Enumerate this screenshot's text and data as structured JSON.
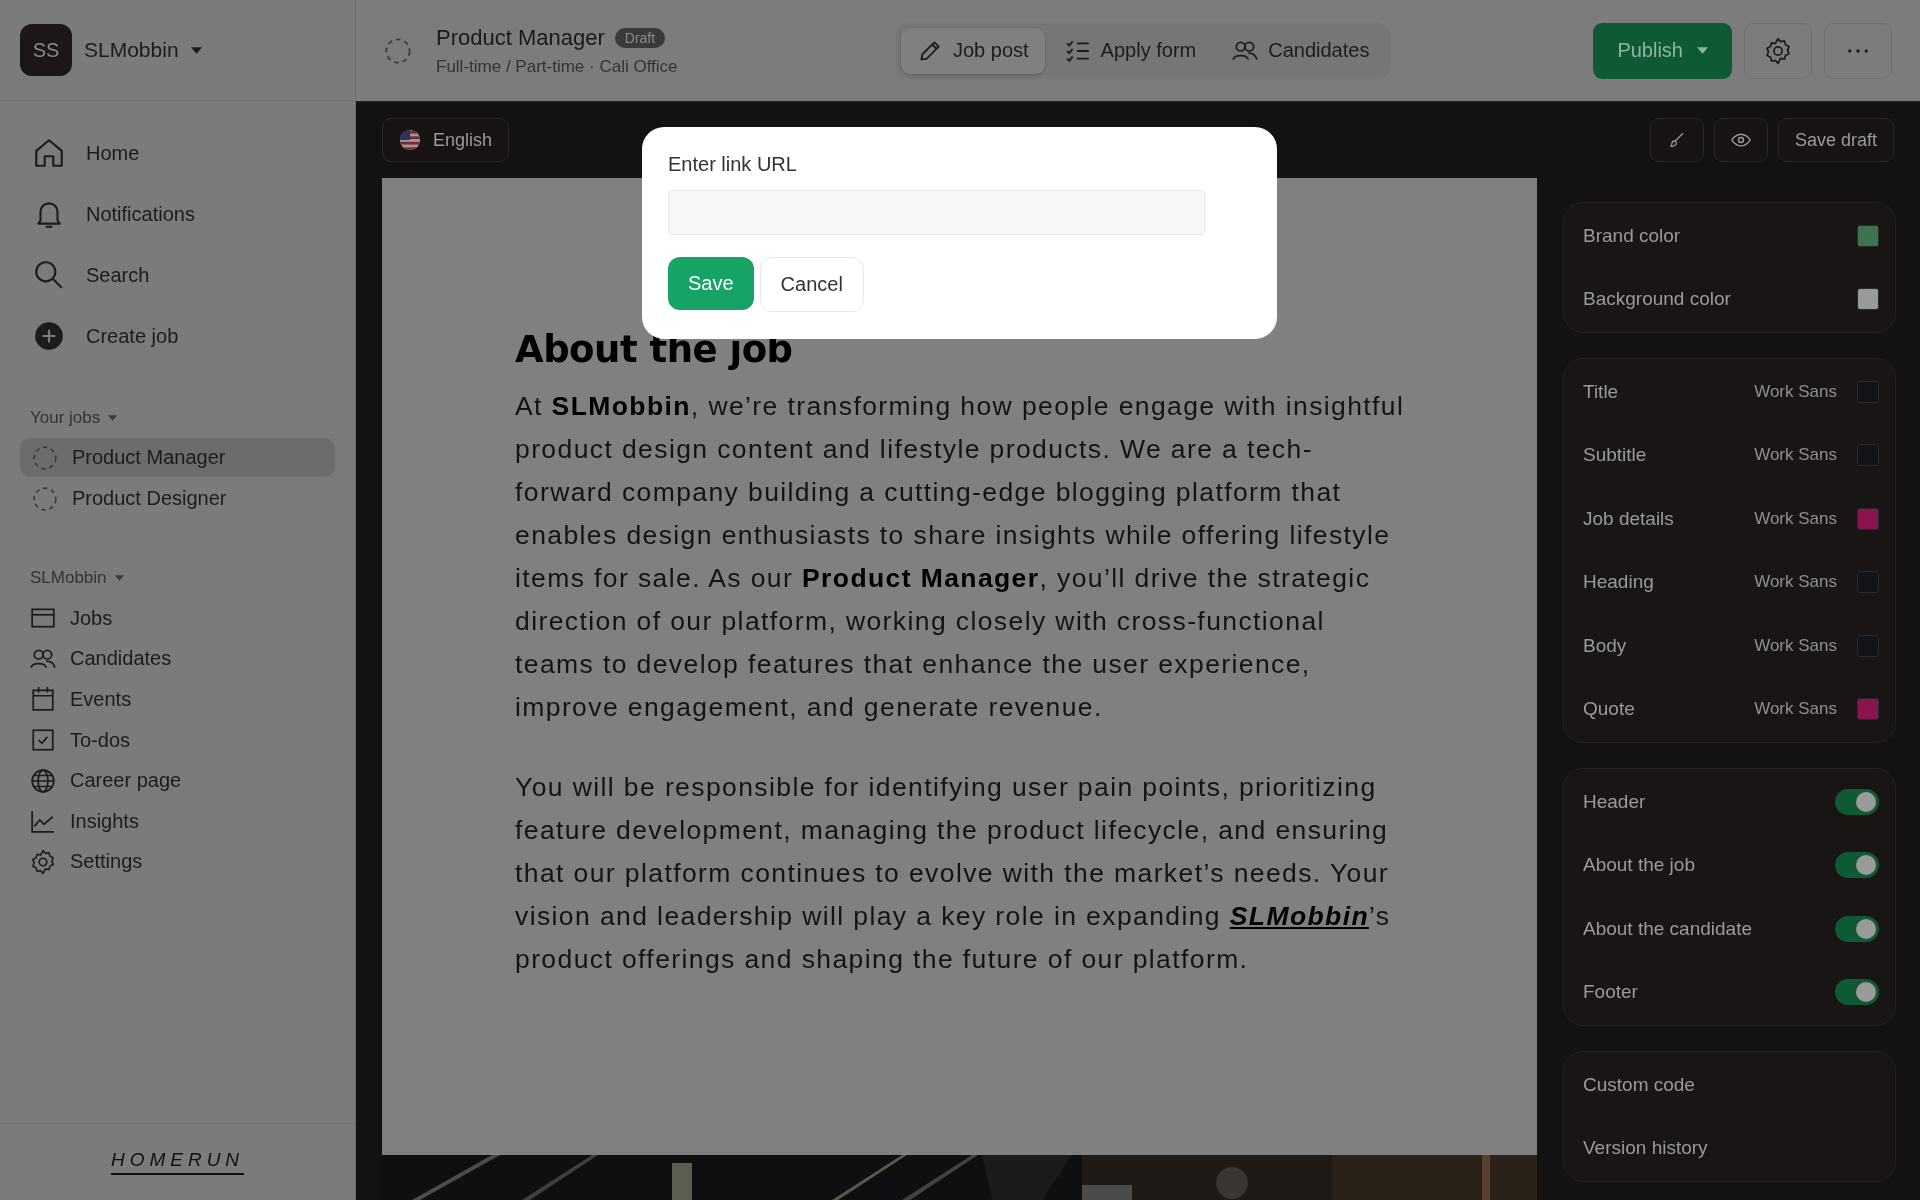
{
  "account": {
    "initials": "SS",
    "name": "SLMobbin"
  },
  "nav": [
    {
      "label": "Home"
    },
    {
      "label": "Notifications"
    },
    {
      "label": "Search"
    },
    {
      "label": "Create job"
    }
  ],
  "your_jobs": {
    "title": "Your jobs",
    "items": [
      {
        "label": "Product Manager",
        "selected": true
      },
      {
        "label": "Product Designer",
        "selected": false
      }
    ]
  },
  "workspace": {
    "title": "SLMobbin",
    "items": [
      {
        "label": "Jobs"
      },
      {
        "label": "Candidates"
      },
      {
        "label": "Events"
      },
      {
        "label": "To-dos"
      },
      {
        "label": "Career page"
      },
      {
        "label": "Insights"
      },
      {
        "label": "Settings"
      }
    ]
  },
  "footer_logo": "HOMERUN",
  "job": {
    "title": "Product Manager",
    "status": "Draft",
    "subtitle": "Full-time / Part-time · Cali Office"
  },
  "tabs": [
    {
      "label": "Job post",
      "selected": true
    },
    {
      "label": "Apply form",
      "selected": false
    },
    {
      "label": "Candidates",
      "selected": false
    }
  ],
  "publish_button": "Publish",
  "toolbar": {
    "language": "English",
    "save_draft": "Save draft"
  },
  "document": {
    "heading": "About the job",
    "paragraphs": [
      {
        "text": "At **SLMobbin**, we’re transforming how people engage with insightful product design content and lifestyle products. We are a tech-forward company building a cutting-edge blogging platform that enables design enthusiasts to share insights while offering lifestyle items for sale. As our **Product Manager**, you’ll drive the strategic direction of our platform, working closely with cross-functional teams to develop features that enhance the user experience, improve engagement, and generate revenue."
      },
      {
        "text": "You will be responsible for identifying user pain points, prioritizing feature development, managing the product lifecycle, and ensuring that our platform continues to evolve with the market’s needs. Your vision and leadership will play a key role in expanding ",
        "link": "SLMobbin",
        "after": "’s product offerings and shaping the future of our platform."
      }
    ]
  },
  "style_panel": {
    "colors": [
      {
        "label": "Brand color",
        "color": "#3d7450"
      },
      {
        "label": "Background color",
        "color": "#9a9a9a"
      }
    ],
    "fonts": [
      {
        "label": "Title",
        "font": "Work Sans",
        "color": "#141418"
      },
      {
        "label": "Subtitle",
        "font": "Work Sans",
        "color": "#141418"
      },
      {
        "label": "Job details",
        "font": "Work Sans",
        "color": "#8a1450"
      },
      {
        "label": "Heading",
        "font": "Work Sans",
        "color": "#141418"
      },
      {
        "label": "Body",
        "font": "Work Sans",
        "color": "#141418"
      },
      {
        "label": "Quote",
        "font": "Work Sans",
        "color": "#8a1450"
      }
    ],
    "sections": [
      {
        "label": "Header",
        "on": true
      },
      {
        "label": "About the job",
        "on": true
      },
      {
        "label": "About the candidate",
        "on": true
      },
      {
        "label": "Footer",
        "on": true
      }
    ],
    "links": [
      "Custom code",
      "Version history"
    ]
  },
  "dialog": {
    "label": "Enter link URL",
    "save": "Save",
    "cancel": "Cancel"
  }
}
